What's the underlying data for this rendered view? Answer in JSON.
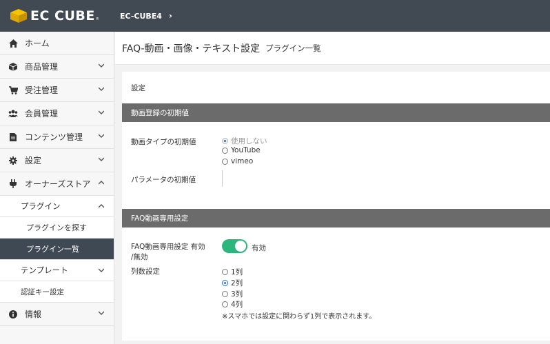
{
  "header": {
    "logo_text": "EC CUBE",
    "logo_sub": "®",
    "shop_name": "EC-CUBE4"
  },
  "sidebar": {
    "items": [
      {
        "label": "ホーム",
        "icon": "home-icon"
      },
      {
        "label": "商品管理",
        "icon": "box-icon"
      },
      {
        "label": "受注管理",
        "icon": "cart-icon"
      },
      {
        "label": "会員管理",
        "icon": "users-icon"
      },
      {
        "label": "コンテンツ管理",
        "icon": "file-icon"
      },
      {
        "label": "設定",
        "icon": "gear-icon"
      },
      {
        "label": "オーナーズストア",
        "icon": "plug-icon"
      }
    ],
    "owners_sub": {
      "plugin": "プラグイン",
      "plugin_search": "プラグインを探す",
      "plugin_list": "プラグイン一覧",
      "template": "テンプレート",
      "auth_key": "認証キー設定"
    },
    "info": {
      "label": "情報",
      "icon": "info-icon"
    }
  },
  "page": {
    "title": "FAQ-動画・画像・テキスト設定",
    "subtitle": "プラグイン一覧"
  },
  "card": {
    "heading": "設定",
    "section1": "動画登録の初期値",
    "video_type_label": "動画タイプの初期値",
    "video_type_options": [
      "使用しない",
      "YouTube",
      "vimeo"
    ],
    "param_label": "パラメータの初期値",
    "section2": "FAQ動画専用設定",
    "enable_label_1": "FAQ動画専用設定 有効",
    "enable_label_2": "/無効",
    "enable_status": "有効",
    "columns_label": "列数設定",
    "columns_options": [
      "1列",
      "2列",
      "3列",
      "4列"
    ],
    "columns_note": "※スマホでは設定に関わらず1列で表示されます。"
  }
}
